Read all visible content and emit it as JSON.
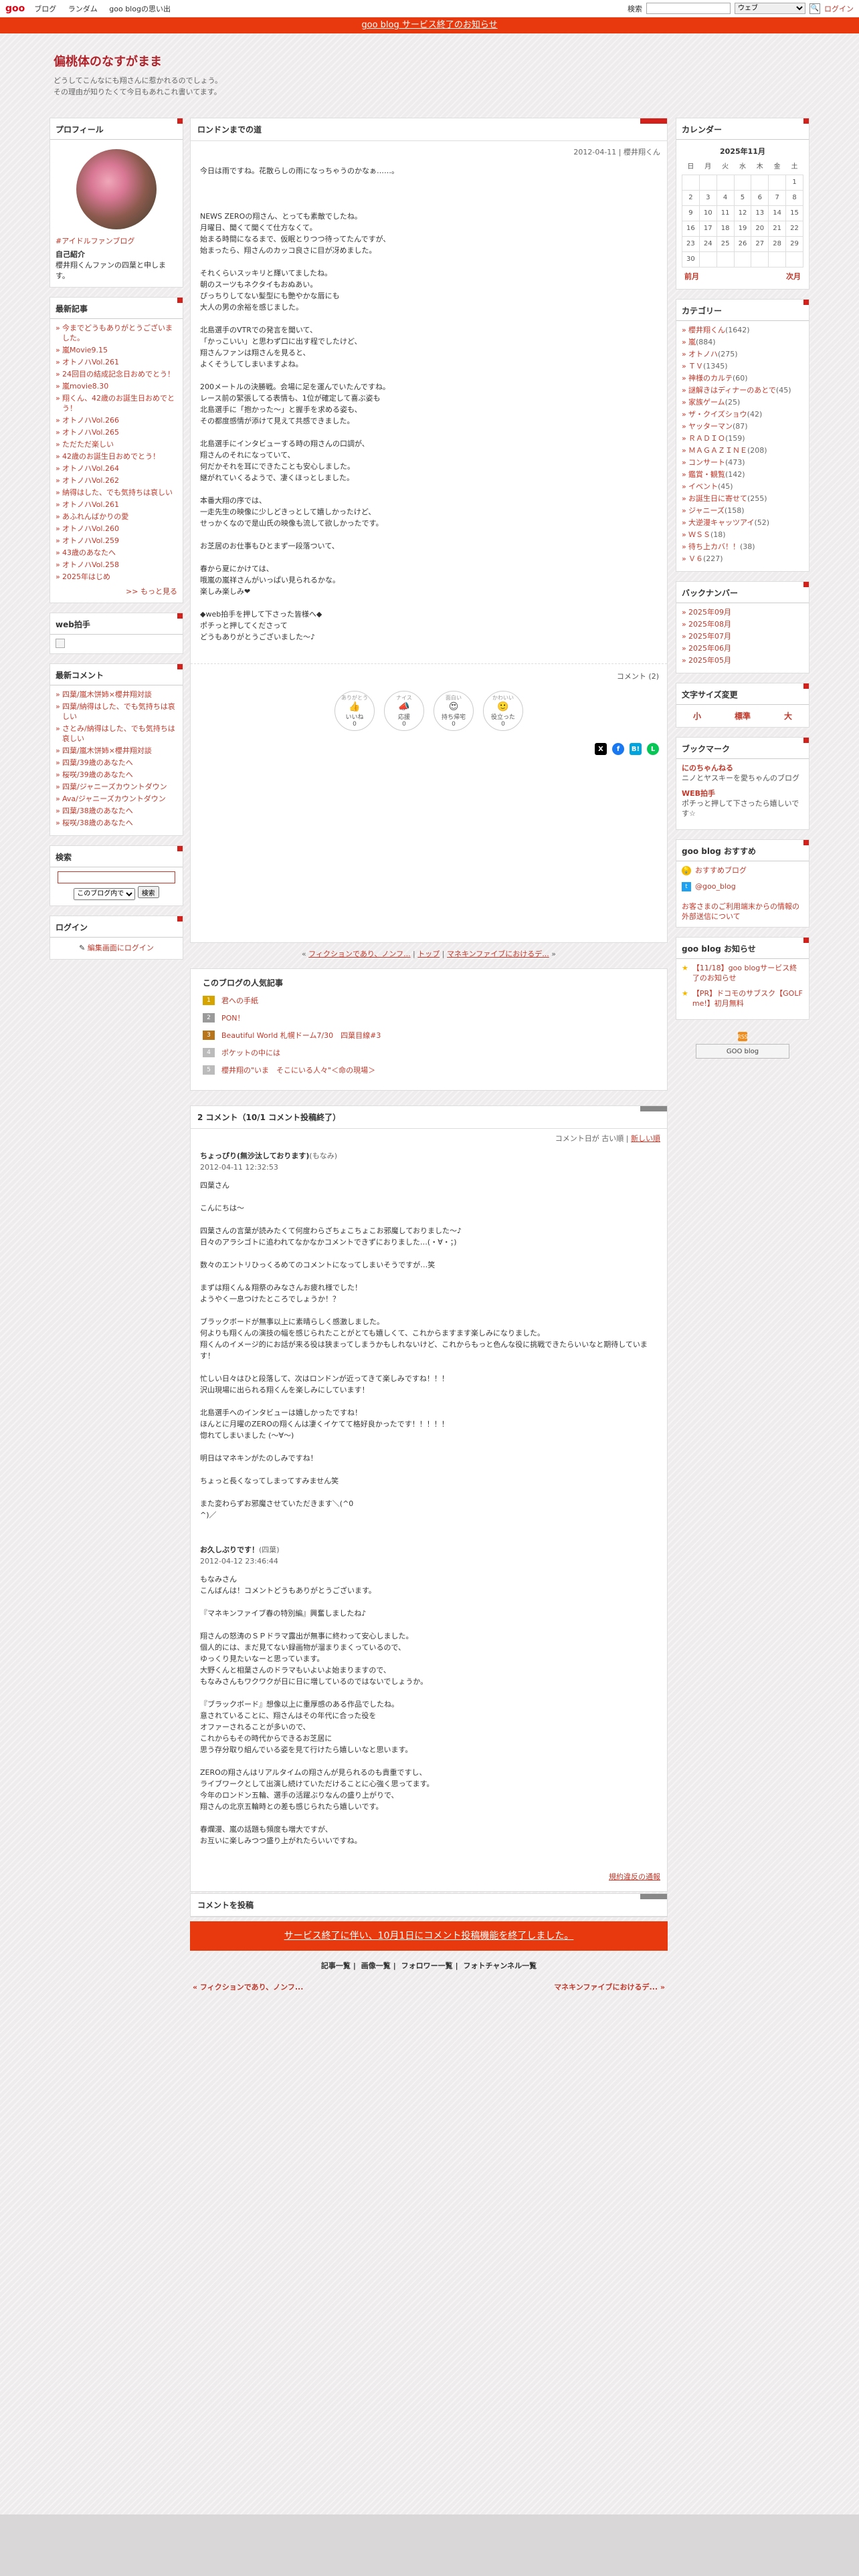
{
  "topbar": {
    "logo": "goo",
    "nav": [
      "ブログ",
      "ランダム",
      "goo blogの思い出"
    ],
    "search_label": "検索",
    "search_placeholder": "",
    "search_scope": "ウェブ",
    "signin": "ログイン"
  },
  "notice": "goo blog サービス終了のお知らせ",
  "header": {
    "title": "偏桃体のなすがまま",
    "desc1": "どうしてこんなにも翔さんに惹かれるのでしょう。",
    "desc2": "その理由が知りたくて今日もあれこれ書いてます。"
  },
  "profile": {
    "title": "プロフィール",
    "name": "#アイドルファンブログ",
    "intro_label": "自己紹介",
    "intro": "櫻井翔くんファンの四葉と申します。"
  },
  "recent": {
    "title": "最新記事",
    "items": [
      "今までどうもありがとうございました。",
      "嵐Movie9.15",
      "オトノハVol.261",
      "24回目の結成記念日おめでとう！",
      "嵐movie8.30",
      "翔くん、42歳のお誕生日おめでとう！",
      "オトノハVol.266",
      "オトノハVol.265",
      "ただただ楽しい",
      "42歳のお誕生日おめでとう！",
      "オトノハVol.264",
      "オトノハVol.262",
      "納得はした、でも気持ちは哀しい",
      "オトノハVol.261",
      "あふれんばかりの愛",
      "オトノハVol.260",
      "オトノハVol.259",
      "43歳のあなたへ",
      "オトノハVol.258",
      "2025年はじめ"
    ],
    "more": ">> もっと見る"
  },
  "web_clap": {
    "title": "web拍手"
  },
  "recent_comments": {
    "title": "最新コメント",
    "items": [
      "四葉/嵐木饼姉×櫻井翔対談",
      "四葉/納得はした、でも気持ちは哀しい",
      "さとみ/納得はした、でも気持ちは哀しい",
      "四葉/嵐木饼姉×櫻井翔対談",
      "四葉/39歳のあなたへ",
      "桜咲/39歳のあなたへ",
      "四葉/ジャニーズカウントダウン",
      "Ava/ジャニーズカウントダウン",
      "四葉/38歳のあなたへ",
      "桜咲/38歳のあなたへ"
    ]
  },
  "search_box": {
    "title": "検索",
    "scope": "このブログ内で",
    "button": "検索"
  },
  "login_box": {
    "title": "ログイン",
    "link": "編集画面にログイン"
  },
  "article": {
    "title": "ロンドンまでの道",
    "meta": "2012-04-11 | 櫻井翔くん",
    "paragraphs": [
      "今日は雨ですね。花散らしの雨になっちゃうのかなぁ……。",
      "NEWS ZEROの翔さん、とっても素敵でしたね。\n月曜日、聞くて聞くて仕方なくて。\n始まる時間になるまで、仮眠とりつつ待ってたんですが、\n始まったら、翔さんのカッコ良さに目が冴めました。",
      "それくらいスッキリと輝いてましたね。\n朝のスーツもネクタイもおぬあい。\nぴっちりしてない髪型にも艶やかな唇にも\n大人の男の余裕を感じました。",
      "北島選手のVTRでの発言を聞いて、\n「かっこいい」と思わず口に出す程でしたけど、\n翔さんファンは翔さんを見ると、\nよくそうしてしまいますよね。",
      "200メートルの決勝戦。会場に足を運んでいたんですね。\nレース前の緊張してる表情も、1位が確定して喜ぶ姿も\n北島選手に「抱かった～」と握手を求める姿も、\nその都度感情が添けて見えて共感できました。",
      "北島選手にインタビューする時の翔さんの口調が、\n翔さんのそれになっていて、\n何だかそれを耳にできたことも安心しました。\n継がれていくるようで、凄くほっとしました。",
      "本番大翔の序では、\n一走先生の映像に少しどきっとして嬉しかったけど、\nせっかくなので是山氏の映像も流して欲しかったです。",
      "お芝居のお仕事もひとまず一段落ついて、",
      "春から夏にかけては、\n哦嵐の嵐祥さんがいっぱい見られるかな。\n楽しみ楽しみ❤",
      "◆web拍手を押して下さった皆様へ◆\nポチっと押してくださって\nどうもありがとうございました～♪"
    ],
    "comment_count": "コメント (2)"
  },
  "reactions": [
    {
      "top": "ありがとう",
      "icon": "👍",
      "label": "いいね",
      "count": "0"
    },
    {
      "top": "ナイス",
      "icon": "📣",
      "label": "応援",
      "count": "0"
    },
    {
      "top": "面白い",
      "icon": "😍",
      "label": "持ち帰宅",
      "count": "0"
    },
    {
      "top": "かわいい",
      "icon": "🙂",
      "label": "役立った",
      "count": "0"
    }
  ],
  "share": {
    "x_label": "X",
    "fb_label": "f",
    "hatena_label": "B!",
    "line_label": "L"
  },
  "pager": {
    "prev": "フィクションであり、ノンフ...",
    "top": "トップ",
    "next": "マネキンファイブにおけるデ..."
  },
  "popular": {
    "title": "このブログの人気記事",
    "items": [
      "君への手紙",
      "PON！",
      "Beautiful World 札幌ドーム7/30　四葉目線#3",
      "ポケットの中には",
      "櫻井翔の\"いま　そこにいる人々\"＜命の現場＞"
    ],
    "ranks": [
      "1",
      "2",
      "3",
      "4",
      "5"
    ]
  },
  "comments": {
    "title": "2 コメント（10/1 コメント投稿終了）",
    "sort_label": "コメント日が",
    "sort_old": "古い順",
    "sort_new": "新しい順",
    "items": [
      {
        "author": "ちょっぴり(無沙汰しております)",
        "sub": "(もなみ)",
        "date": "2012-04-11 12:32:53",
        "paragraphs": [
          "四葉さん",
          "こんにちは～",
          "四葉さんの言葉が読みたくて何度わらざちょこちょこお邪魔しておりました～♪\n日々のアラシゴトに追われてなかなかコメントできずにおりました…(・∀・；)",
          "数々のエントリひっくるめてのコメントになってしまいそうですが…笑",
          "まずは翔くん＆翔祭のみなさんお疲れ様でした！\nようやく一息つけたところでしょうか！？",
          "ブラックボードが無事以上に素晴らしく感激しました。\n何よりも翔くんの演技の幅を感じられたことがとても嬉しくて、これからますます楽しみになりました。\n翔くんのイメージ的にお話が来る役は狭まってしまうかもしれないけど、これからもっと色んな役に挑戦できたらいいなと期待しています！",
          "忙しい日々はひと段落して、次はロンドンが近ってきて楽しみですね！！！\n沢山現場に出られる翔くんを楽しみにしています！",
          "北島選手へのインタビューは嬉しかったですね！\nほんとに月曜のZEROの翔くんは凄くイケてて格好良かったです！！！！！\n惚れてしまいました (～∀～)",
          "明日はマネキンがたのしみですね！",
          "ちょっと長くなってしまってすみません笑",
          "また変わらずお邪魔させていただきます＼(^0\n^)／"
        ]
      },
      {
        "author": "お久しぶりです！",
        "sub": "(四葉)",
        "date": "2012-04-12 23:46:44",
        "paragraphs": [
          "もなみさん\nこんばんは！コメントどうもありがとうございます。",
          "『マネキンファイブ春の特別編』興奮しましたね♪",
          "翔さんの怒涛のＳＰドラマ露出が無事に終わって安心しました。\n個人的には、まだ見てない録画物が溜まりまくっているので、\nゆっくり見たいなーと思っています。\n大野くんと相葉さんのドラマもいよいよ始まりますので、\nもなみさんもワクワクが日に日に増しているのではないでしょうか。",
          "『ブラックボード』想像以上に重厚感のある作品でしたね。\n意されていることに、翔さんはその年代に合った役を\nオファーされることが多いので、\nこれからもその時代からできるお芝居に\n思う存分取り組んでいる姿を見て行けたら嬉しいなと思います。",
          "ZEROの翔さんはリアルタイムの翔さんが見られるのも貴重ですし、\nライブワークとして出演し続けていただけることに心強く思ってます。\n今年のロンドン五輪、選手の活躍ぶりなんの盛り上がりで、\n翔さんの北京五輪時との差も感じられたら嬉しいです。",
          "春爛漫、嵐の話題も頻度も増大ですが、\nお互いに楽しみつつ盛り上がれたらいいですね。"
        ]
      }
    ],
    "report": "規約違反の通報"
  },
  "post": {
    "title": "コメントを投稿",
    "banner": "サービス終了に伴い、10月1日にコメント投稿機能を終了しました。",
    "links": [
      "記事一覧",
      "画像一覧",
      "フォロワー一覧",
      "フォトチャンネル一覧"
    ],
    "prev": "« フィクションであり、ノンフ...",
    "next": "マネキンファイブにおけるデ... »"
  },
  "calendar": {
    "title": "カレンダー",
    "caption": "2025年11月",
    "weekdays": [
      "日",
      "月",
      "火",
      "水",
      "木",
      "金",
      "土"
    ],
    "weeks": [
      [
        "",
        "",
        "",
        "",
        "",
        "",
        "1"
      ],
      [
        "2",
        "3",
        "4",
        "5",
        "6",
        "7",
        "8"
      ],
      [
        "9",
        "10",
        "11",
        "12",
        "13",
        "14",
        "15"
      ],
      [
        "16",
        "17",
        "18",
        "19",
        "20",
        "21",
        "22"
      ],
      [
        "23",
        "24",
        "25",
        "26",
        "27",
        "28",
        "29"
      ],
      [
        "30",
        "",
        "",
        "",
        "",
        "",
        ""
      ]
    ],
    "prev": "前月",
    "next": "次月"
  },
  "categories": {
    "title": "カテゴリー",
    "items": [
      {
        "name": "櫻井翔くん",
        "count": "(1642)"
      },
      {
        "name": "嵐",
        "count": "(884)"
      },
      {
        "name": "オトノハ",
        "count": "(275)"
      },
      {
        "name": "ＴＶ",
        "count": "(1345)"
      },
      {
        "name": "神様のカルテ",
        "count": "(60)"
      },
      {
        "name": "謎解きはディナーのあとで",
        "count": "(45)"
      },
      {
        "name": "家族ゲーム",
        "count": "(25)"
      },
      {
        "name": "ザ・クイズショウ",
        "count": "(42)"
      },
      {
        "name": "ヤッターマン",
        "count": "(87)"
      },
      {
        "name": "ＲＡＤＩＯ",
        "count": "(159)"
      },
      {
        "name": "ＭＡＧＡＺＩＮＥ",
        "count": "(208)"
      },
      {
        "name": "コンサート",
        "count": "(473)"
      },
      {
        "name": "鑑賞・観覧",
        "count": "(142)"
      },
      {
        "name": "イベント",
        "count": "(45)"
      },
      {
        "name": "お誕生日に寄せて",
        "count": "(255)"
      },
      {
        "name": "ジャニーズ",
        "count": "(158)"
      },
      {
        "name": "大逆漫キャッツアイ",
        "count": "(52)"
      },
      {
        "name": "ＷＳＳ",
        "count": "(18)"
      },
      {
        "name": "待ち上カバ！！",
        "count": "(38)"
      },
      {
        "name": "Ｖ６",
        "count": "(227)"
      }
    ]
  },
  "backnumber": {
    "title": "バックナンバー",
    "items": [
      "2025年09月",
      "2025年08月",
      "2025年07月",
      "2025年06月",
      "2025年05月"
    ]
  },
  "font_size": {
    "title": "文字サイズ変更",
    "small": "小",
    "medium": "標準",
    "large": "大"
  },
  "bookmark": {
    "title": "ブックマーク",
    "items": [
      {
        "title": "にのちゃんねる",
        "desc": "ニノとヤスキーを愛ちゃんのブログ"
      },
      {
        "title": "WEB拍手",
        "desc": "ポチっと押して下さったら嬉しいです☆"
      }
    ]
  },
  "osusume": {
    "title": "goo blog おすすめ",
    "item1": "おすすめブログ",
    "item2": "@goo_blog",
    "notice": "お客さまのご利用端末からの情報の外部送信について"
  },
  "info": {
    "title": "goo blog お知らせ",
    "items": [
      "【11/18】goo blogサービス終了のお知らせ",
      "【PR】ドコモのサブスク【GOLF me!】初月無料"
    ],
    "rss": "RSS",
    "goo_badge": "GOO blog"
  },
  "colors": {
    "accent": "#d4201b",
    "link": "#c0392b",
    "notice_bg": "#e8390e"
  }
}
